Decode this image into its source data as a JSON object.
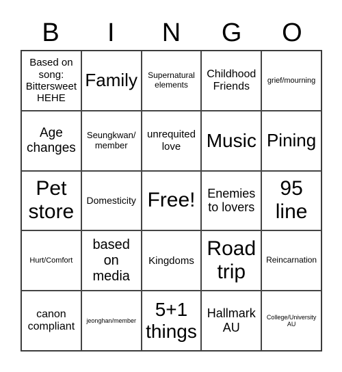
{
  "header": [
    "B",
    "I",
    "N",
    "G",
    "O"
  ],
  "cells": [
    "Based on song: Bittersweet HEHE",
    "Family",
    "Supernatural elements",
    "Childhood Friends",
    "grief/mourning",
    "Age changes",
    "Seungkwan/ member",
    "unrequited love",
    "Music",
    "Pining",
    "Pet store",
    "Domesticity",
    "Free!",
    "Enemies to lovers",
    "95 line",
    "Hurt/Comfort",
    "based on media",
    "Kingdoms",
    "Road trip",
    "Reincarnation",
    "canon compliant",
    "jeonghan/member",
    "5+1 things",
    "Hallmark AU",
    "College/University AU"
  ]
}
